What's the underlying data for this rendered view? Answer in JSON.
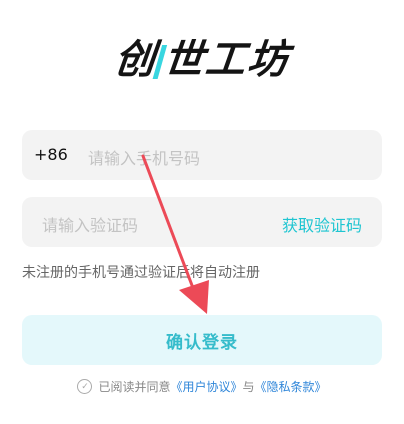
{
  "app": {
    "logo_left": "创",
    "logo_right": "世工坊"
  },
  "login": {
    "phone_prefix": "+86",
    "phone_placeholder": "请输入手机号码",
    "code_placeholder": "请输入验证码",
    "get_code_label": "获取验证码",
    "hint": "未注册的手机号通过验证后将自动注册",
    "confirm_label": "确认登录"
  },
  "agreement": {
    "check_icon": "check-circle-icon",
    "prefix": "已阅读并同意",
    "user_agreement": "《用户协议》",
    "and": "与",
    "privacy_policy": "《隐私条款》"
  },
  "colors": {
    "accent": "#1ec5d1",
    "button_bg": "#e4f8fb",
    "link": "#2f86d9",
    "arrow": "#ec4a57"
  }
}
